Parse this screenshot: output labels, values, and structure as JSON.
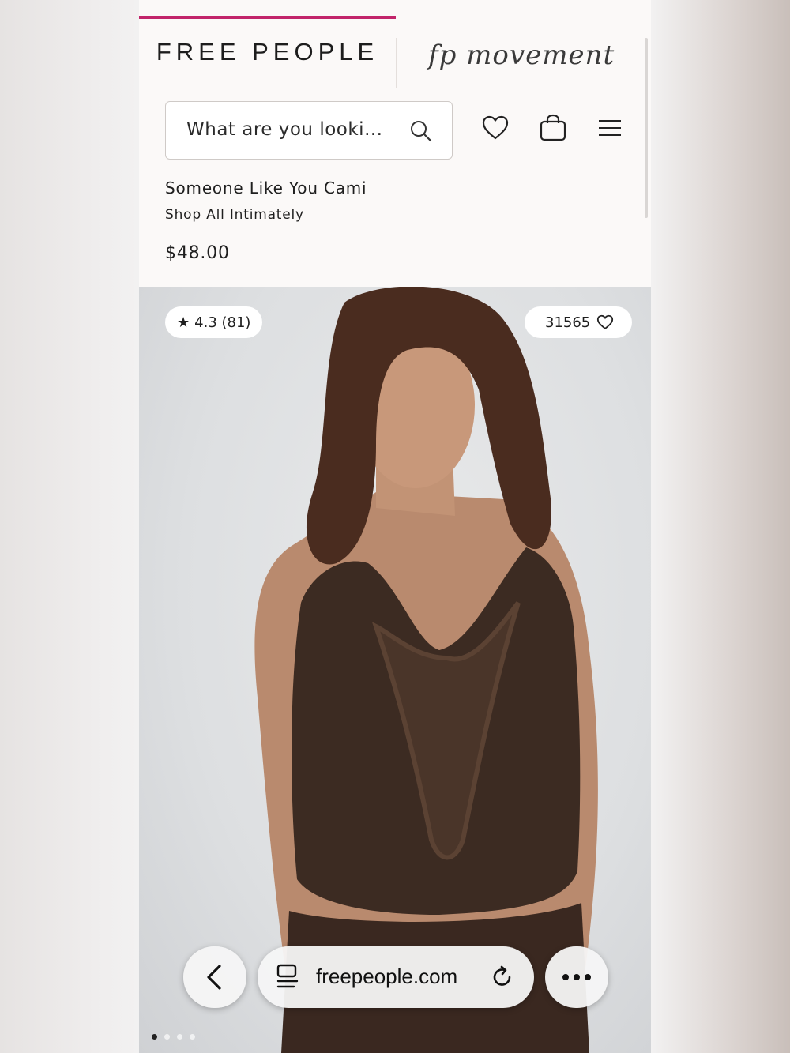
{
  "header": {
    "brand": "FREE PEOPLE",
    "secondary_brand": "fp movement",
    "active_tab_color": "#c2256b"
  },
  "search": {
    "placeholder": "What are you looki..."
  },
  "header_icons": [
    "heart-icon",
    "bag-icon",
    "menu-icon"
  ],
  "product": {
    "title": "Someone Like You Cami",
    "category_link": "Shop All Intimately",
    "price": "$48.00",
    "rating": "4.3 (81)",
    "favorites": "31565",
    "image_pages": 4,
    "active_image_index": 0
  },
  "browser": {
    "url": "freepeople.com",
    "back_icon": "chevron-left-icon",
    "tabs_icon": "page-menu-icon",
    "reload_icon": "reload-icon",
    "more_icon": "more-icon"
  }
}
